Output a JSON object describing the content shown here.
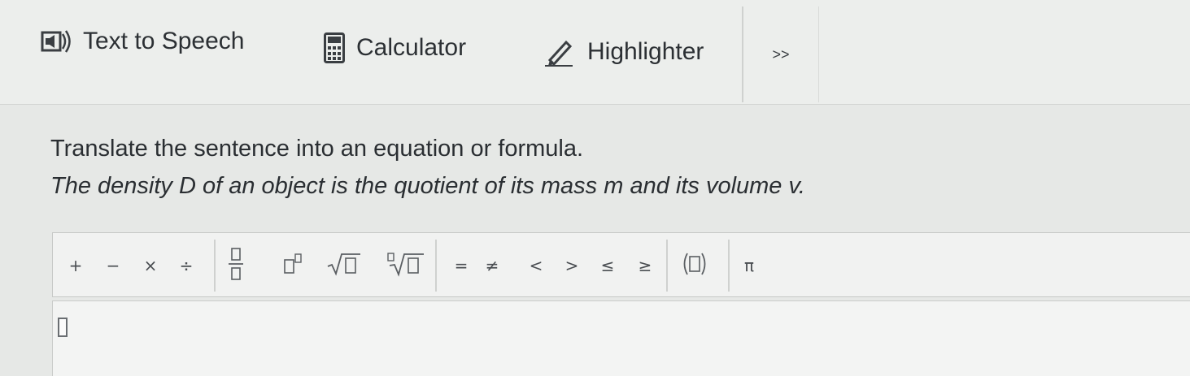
{
  "toolbar": {
    "text_to_speech": "Text to Speech",
    "calculator": "Calculator",
    "highlighter": "Highlighter",
    "more": ">>"
  },
  "question": {
    "prompt": "Translate the sentence into an equation or formula.",
    "sentence": "The density D of an object is the quotient of its mass m and its volume v."
  },
  "math_toolbar": {
    "plus": "+",
    "minus": "−",
    "times": "×",
    "divide": "÷",
    "equals": "=",
    "not_equal": "≠",
    "less_than": "<",
    "greater_than": ">",
    "less_equal": "≤",
    "greater_equal": "≥",
    "pi": "π"
  },
  "icons": {
    "tts": "speaker-icon",
    "calculator": "calculator-icon",
    "highlighter": "pencil-icon"
  }
}
